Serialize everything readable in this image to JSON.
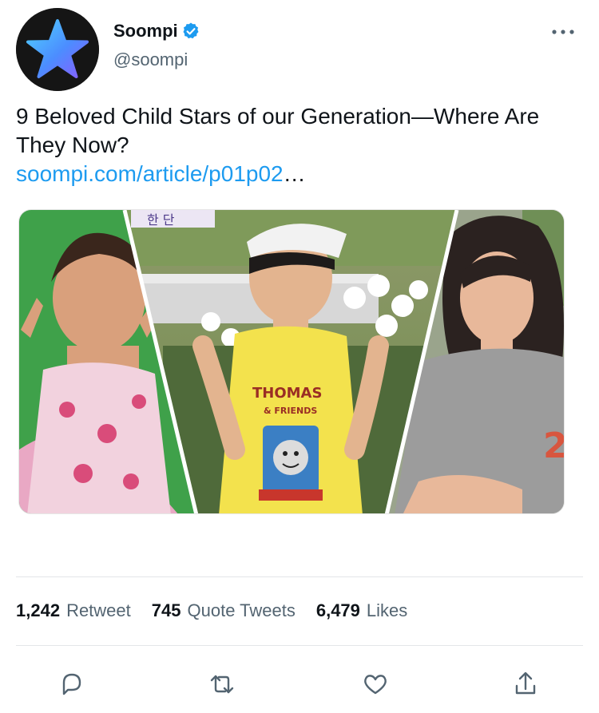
{
  "tweet": {
    "display_name": "Soompi",
    "handle": "@soompi",
    "text": "9 Beloved Child Stars of our Generation—Where Are They Now?",
    "link_url": "soompi.com/article/p01p02",
    "link_ellipsis": "…",
    "verified": true
  },
  "media": {
    "banner_text": "한 단",
    "shirt_text_1": "THOMAS",
    "shirt_text_2": "& FRIENDS",
    "shirt_number": "2"
  },
  "stats": {
    "retweets_count": "1,242",
    "retweets_label": "Retweet",
    "quotes_count": "745",
    "quotes_label": "Quote Tweets",
    "likes_count": "6,479",
    "likes_label": "Likes"
  },
  "icons": {
    "avatar": "star-logo-icon",
    "verified": "verified-badge-icon",
    "more": "more-options-icon",
    "reply": "reply-icon",
    "retweet": "retweet-icon",
    "like": "heart-icon",
    "share": "share-icon"
  },
  "colors": {
    "link": "#1d9bf0",
    "verified": "#1d9bf0",
    "secondary_text": "#536471",
    "avatar_bg": "#151515"
  }
}
